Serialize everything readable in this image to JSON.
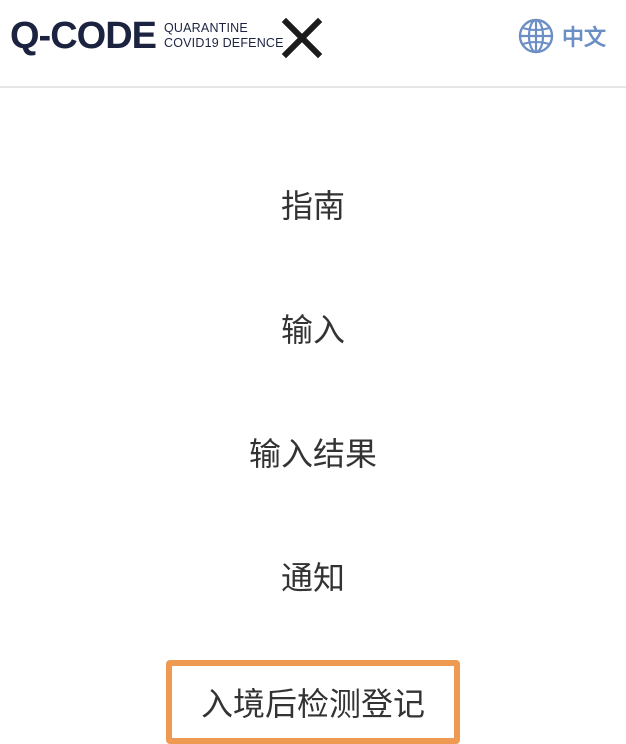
{
  "header": {
    "logo": {
      "main": "Q-CODE",
      "sub_line1": "QUARANTINE",
      "sub_line2": "COVID19 DEFENCE"
    },
    "close_icon": "close-icon",
    "language": {
      "icon": "globe-icon",
      "label": "中文"
    }
  },
  "menu": {
    "items": [
      {
        "label": "指南"
      },
      {
        "label": "输入"
      },
      {
        "label": "输入结果"
      },
      {
        "label": "通知"
      },
      {
        "label": "入境后检测登记"
      }
    ]
  },
  "colors": {
    "brand_navy": "#1b2340",
    "brand_red": "#c8324a",
    "language_blue": "#6b8fc4",
    "highlight_orange": "#ef9a52",
    "menu_text": "#333333"
  }
}
